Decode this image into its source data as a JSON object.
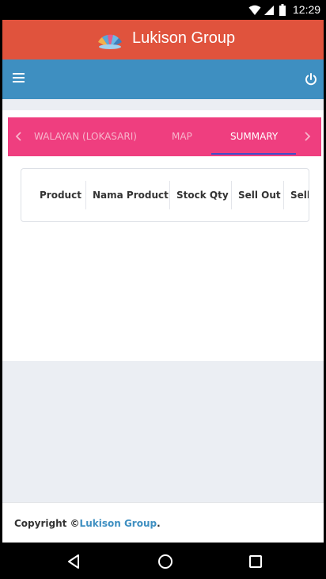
{
  "status_bar": {
    "time": "12:29"
  },
  "header": {
    "title": "Lukison Group",
    "logo": "lukison-logo"
  },
  "navbar": {
    "menu_icon": "hamburger-icon",
    "power_icon": "power-icon"
  },
  "tabs": {
    "items": [
      {
        "label": "WALAYAN (LOKASARI)",
        "active": false
      },
      {
        "label": "MAP",
        "active": false
      },
      {
        "label": "SUMMARY",
        "active": true
      }
    ],
    "prev_icon": "chevron-left-icon",
    "next_icon": "chevron-right-icon"
  },
  "table": {
    "columns": [
      "Product",
      "Nama Product",
      "Stock Qty",
      "Sell Out",
      "Sell"
    ]
  },
  "footer": {
    "prefix": "Copyright ©",
    "link": "Lukison Group",
    "suffix": "."
  },
  "colors": {
    "header_bg": "#e0533d",
    "navbar_bg": "#3e8fc1",
    "tab_bg": "#ef3e7f",
    "tab_active_underline": "#3f4fc7",
    "page_bg": "#ebeef3"
  }
}
